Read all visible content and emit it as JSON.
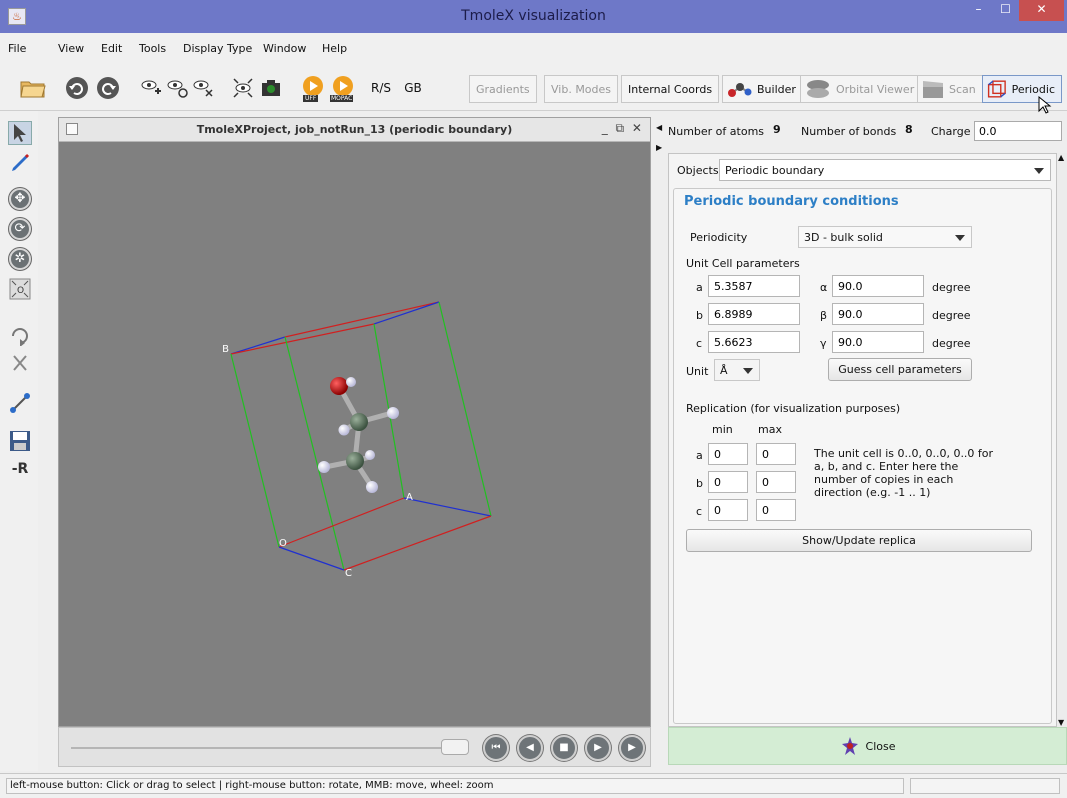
{
  "window": {
    "title": "TmoleX visualization",
    "app_icon_glyph": "♨",
    "minimize": "–",
    "maximize": "☐",
    "close": "✕"
  },
  "menu": [
    "File",
    "View",
    "Edit",
    "Tools",
    "Display Type",
    "Window",
    "Help"
  ],
  "toolbar": {
    "uff_label": "UFF",
    "mopac_label": "MOPAC",
    "rs_label": "R/S",
    "gb_label": "GB",
    "gradients": "Gradients",
    "vib_modes": "Vib. Modes",
    "internal_coords": "Internal Coords",
    "builder": "Builder",
    "orbital_viewer": "Orbital Viewer",
    "scan": "Scan",
    "periodic": "Periodic"
  },
  "left_tools": {
    "minus_r": "-R"
  },
  "viewer": {
    "title": "TmoleXProject, job_notRun_13 (periodic boundary)",
    "controls": "_ ⧉ ✕",
    "cell_labels": {
      "b": "B",
      "a": "A",
      "o": "O",
      "c": "C"
    }
  },
  "playback": {
    "first": "⏮",
    "prev": "◀",
    "stop": "■",
    "next": "▶",
    "last": "▶"
  },
  "info": {
    "atoms_label": "Number of atoms",
    "atoms_value": "9",
    "bonds_label": "Number of bonds",
    "bonds_value": "8",
    "charge_label": "Charge",
    "charge_value": "0.0"
  },
  "objects": {
    "label": "Objects",
    "selected": "Periodic boundary"
  },
  "pbc": {
    "title": "Periodic boundary conditions",
    "periodicity_label": "Periodicity",
    "periodicity_value": "3D - bulk solid",
    "unit_cell_label": "Unit Cell parameters",
    "a_label": "a",
    "a_value": "5.3587",
    "b_label": "b",
    "b_value": "6.8989",
    "c_label": "c",
    "c_value": "5.6623",
    "alpha_label": "α",
    "alpha_value": "90.0",
    "beta_label": "β",
    "beta_value": "90.0",
    "gamma_label": "γ",
    "gamma_value": "90.0",
    "degree": "degree",
    "unit_label": "Unit",
    "unit_value": "Å",
    "guess_button": "Guess cell parameters",
    "replication_label": "Replication (for visualization purposes)",
    "min_label": "min",
    "max_label": "max",
    "rep_a_min": "0",
    "rep_a_max": "0",
    "rep_b_min": "0",
    "rep_b_max": "0",
    "rep_c_min": "0",
    "rep_c_max": "0",
    "replica_note": "The unit cell is 0..0, 0..0, 0..0 for a, b, and c. Enter here the number of copies in each direction (e.g. -1 .. 1)",
    "update_button": "Show/Update replica"
  },
  "close_button": "Close",
  "status": "left-mouse button: Click or drag to select | right-mouse button: rotate, MMB: move, wheel: zoom"
}
